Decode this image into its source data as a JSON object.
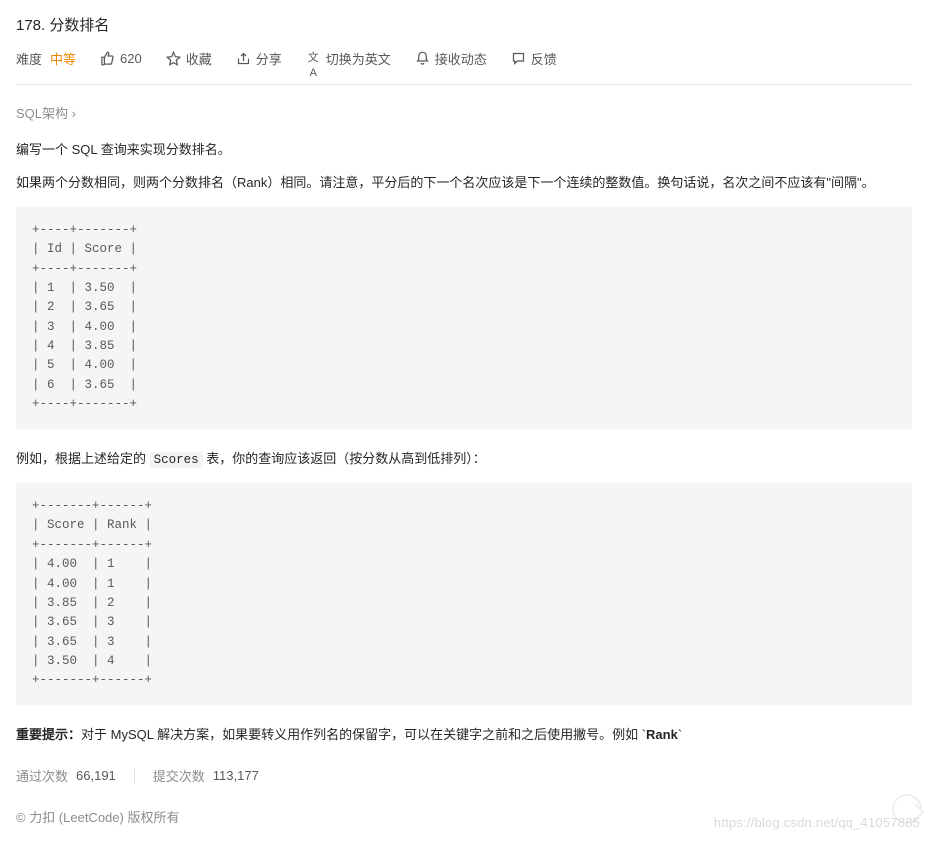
{
  "title": "178. 分数排名",
  "toolbar": {
    "difficulty_label": "难度",
    "difficulty_value": "中等",
    "like_count": "620",
    "favorite_label": "收藏",
    "share_label": "分享",
    "switch_label": "切换为英文",
    "notify_label": "接收动态",
    "feedback_label": "反馈"
  },
  "schema_link": "SQL架构 ›",
  "content": {
    "p1": "编写一个 SQL 查询来实现分数排名。",
    "p2": "如果两个分数相同，则两个分数排名（Rank）相同。请注意，平分后的下一个名次应该是下一个连续的整数值。换句话说，名次之间不应该有\"间隔\"。",
    "code1": "+----+-------+\n| Id | Score |\n+----+-------+\n| 1  | 3.50  |\n| 2  | 3.65  |\n| 3  | 4.00  |\n| 4  | 3.85  |\n| 5  | 4.00  |\n| 6  | 3.65  |\n+----+-------+",
    "p3_a": "例如，根据上述给定的 ",
    "p3_code": "Scores",
    "p3_b": " 表，你的查询应该返回（按分数从高到低排列）：",
    "code2": "+-------+------+\n| Score | Rank |\n+-------+------+\n| 4.00  | 1    |\n| 4.00  | 1    |\n| 3.85  | 2    |\n| 3.65  | 3    |\n| 3.65  | 3    |\n| 3.50  | 4    |\n+-------+------+",
    "hint_label": "重要提示：",
    "hint_body": "对于 MySQL 解决方案，如果要转义用作列名的保留字，可以在关键字之前和之后使用撇号。例如 `",
    "hint_rank": "Rank",
    "hint_tail": "`"
  },
  "stats": {
    "accepted_label": "通过次数",
    "accepted_value": "66,191",
    "submissions_label": "提交次数",
    "submissions_value": "113,177"
  },
  "copyright": "© 力扣 (LeetCode) 版权所有",
  "watermark": "https://blog.csdn.net/qq_41057885"
}
